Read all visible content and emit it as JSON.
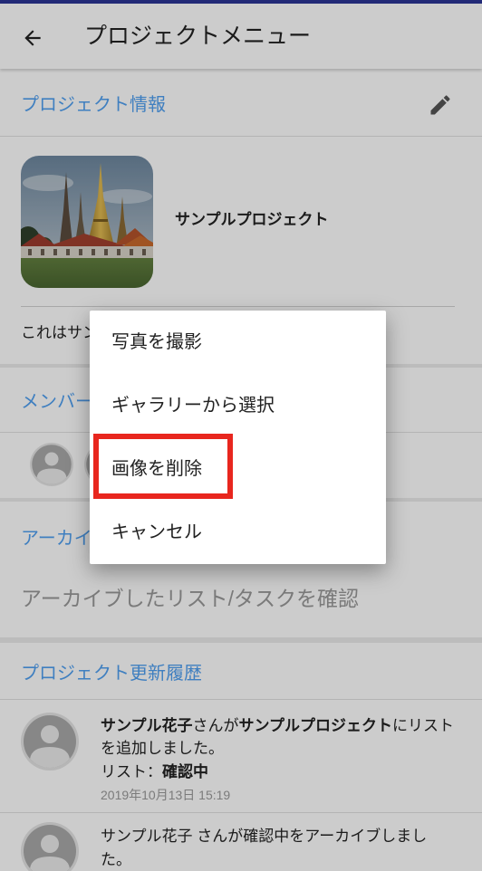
{
  "app_bar": {
    "title": "プロジェクトメニュー",
    "back_icon": "arrow-left-icon"
  },
  "project_info": {
    "header": "プロジェクト情報",
    "edit_icon": "pencil-icon",
    "name": "サンプルプロジェクト",
    "description": "これはサン"
  },
  "members": {
    "header": "メンバー",
    "avatar_icon": "default-avatar-icon"
  },
  "archive": {
    "header": "アーカイ",
    "link": "アーカイブしたリスト/タスクを確認"
  },
  "history": {
    "header": "プロジェクト更新履歴",
    "items": [
      {
        "lines": [
          [
            "サンプル花子",
            "さんが",
            "サンプルプロジェクト",
            "にリスト"
          ],
          [
            "を追加しました。"
          ],
          [
            "リスト：",
            "確認中"
          ]
        ],
        "timestamp": "2019年10月13日 15:19"
      },
      {
        "lines": [
          [
            "サンプル花子 さんが確認中をアーカイブしまし"
          ],
          [
            "た。"
          ]
        ]
      }
    ]
  },
  "dialog": {
    "items": [
      {
        "label": "写真を撮影"
      },
      {
        "label": "ギャラリーから選択"
      },
      {
        "label": "画像を削除",
        "highlighted": true
      },
      {
        "label": "キャンセル"
      }
    ]
  },
  "colors": {
    "accent": "#4f9ff0",
    "highlight": "#e8261e",
    "status_bar": "#2b3595",
    "scrim": "rgba(0,0,0,0.2)"
  }
}
